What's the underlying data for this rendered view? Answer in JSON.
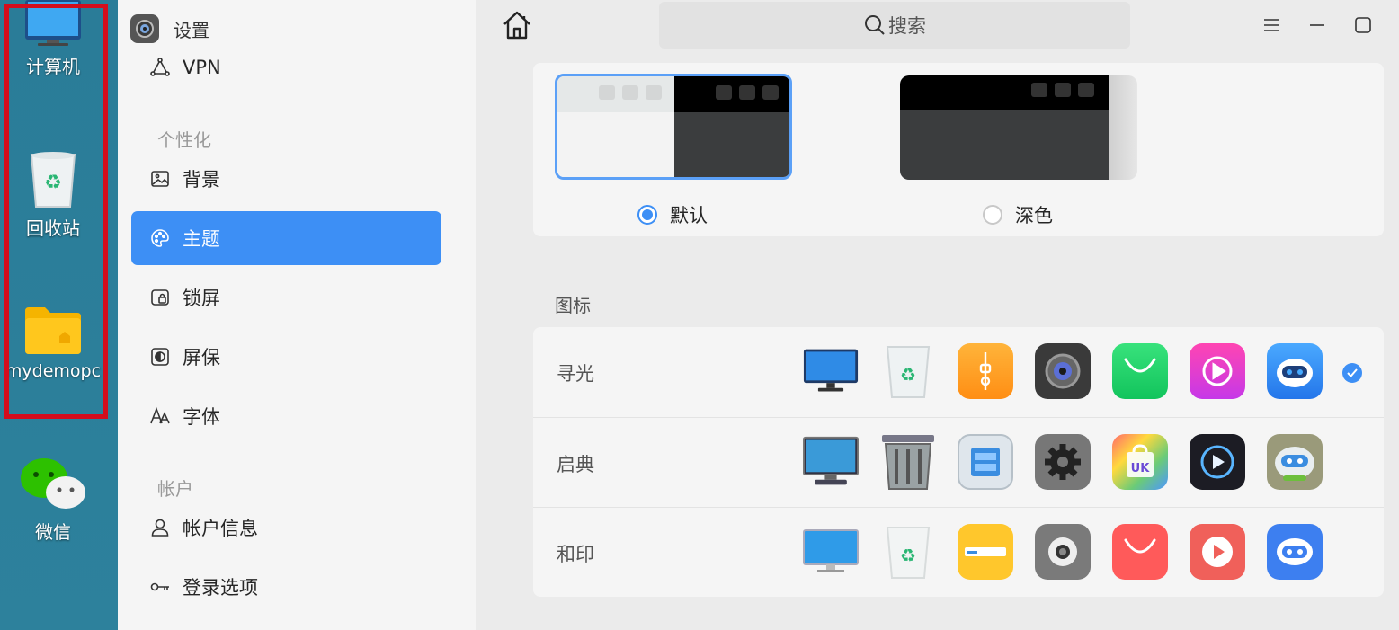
{
  "desktop": {
    "icons": [
      {
        "label": "计算机",
        "icon": "computer-icon"
      },
      {
        "label": "回收站",
        "icon": "trash-icon"
      },
      {
        "label": "mydemopc",
        "icon": "home-folder-icon"
      },
      {
        "label": "微信",
        "icon": "wechat-icon"
      }
    ],
    "highlight_color": "#d40d1c"
  },
  "window": {
    "title": "设置",
    "search_placeholder": "搜索"
  },
  "sidebar": {
    "items": [
      {
        "label": "VPN",
        "icon": "vpn-icon"
      },
      {
        "section": "个性化"
      },
      {
        "label": "背景",
        "icon": "image-icon"
      },
      {
        "label": "主题",
        "icon": "palette-icon",
        "active": true
      },
      {
        "label": "锁屏",
        "icon": "lock-screen-icon"
      },
      {
        "label": "屏保",
        "icon": "screensaver-icon"
      },
      {
        "label": "字体",
        "icon": "font-icon"
      },
      {
        "section": "帐户"
      },
      {
        "label": "帐户信息",
        "icon": "user-icon"
      },
      {
        "label": "登录选项",
        "icon": "key-icon"
      }
    ]
  },
  "theme": {
    "options": [
      {
        "label": "默认",
        "selected": true
      },
      {
        "label": "深色",
        "selected": false
      }
    ]
  },
  "icons_section": {
    "title": "图标",
    "sets": [
      {
        "name": "寻光",
        "selected": true
      },
      {
        "name": "启典",
        "selected": false
      },
      {
        "name": "和印",
        "selected": false
      }
    ]
  },
  "colors": {
    "accent": "#3d8ff5"
  }
}
